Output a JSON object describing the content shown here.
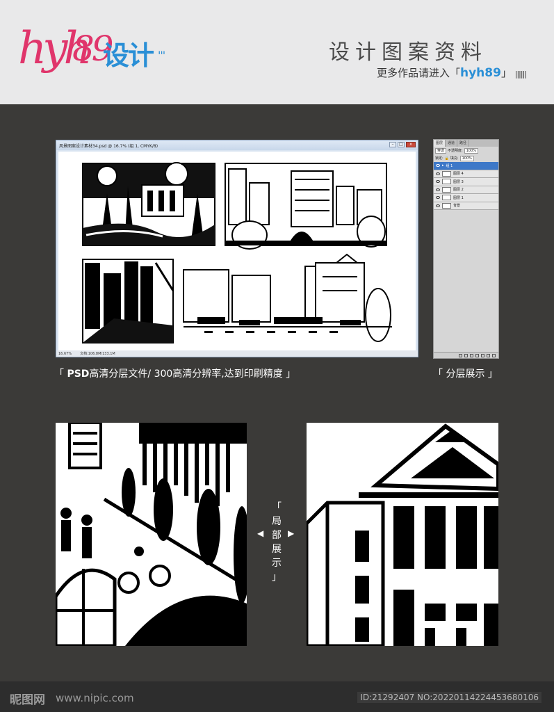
{
  "header": {
    "logo_latin": "hyh",
    "logo_num": "89",
    "logo_cn": "设计",
    "logo_dots": "'''",
    "title": "设计图案资料",
    "sub_prefix": "更多作品请进入「",
    "sub_highlight": "hyh89",
    "sub_suffix": "」",
    "sub_bars": "||||||"
  },
  "ps_window": {
    "title": "风景图案设计素材34.psd @ 16.7% (组 1, CMYK/8)",
    "minimize": "–",
    "maximize": "□",
    "close": "x",
    "zoom": "16.67%",
    "doc_size": "文档:106.8M/133.1M"
  },
  "layers_panel": {
    "tabs": [
      "图层",
      "通道",
      "路径"
    ],
    "blend_mode": "穿透",
    "opacity_label": "不透明度:",
    "opacity_value": "100%",
    "lock_label": "锁定:",
    "fill_label": "填充:",
    "fill_value": "100%",
    "items": [
      {
        "name": "组 1",
        "selected": true
      },
      {
        "name": "图层 4",
        "selected": false
      },
      {
        "name": "图层 3",
        "selected": false
      },
      {
        "name": "图层 2",
        "selected": false
      },
      {
        "name": "图层 1",
        "selected": false
      },
      {
        "name": "背景",
        "selected": false
      }
    ]
  },
  "captions": {
    "psd_open": "「 ",
    "psd_bold": "PSD",
    "psd_text": "高清分层文件/ 300高清分辨率,达到印刷精度 」",
    "layers": "「 分层展示 」",
    "detail_chars": [
      "「",
      "局",
      "部",
      "展",
      "示",
      "」"
    ],
    "arrow_left": "◀",
    "arrow_right": "▶"
  },
  "footer": {
    "logo": "昵图网",
    "url": "www.nipic.com",
    "id": "ID:21292407 NO:20220114224453680106"
  }
}
